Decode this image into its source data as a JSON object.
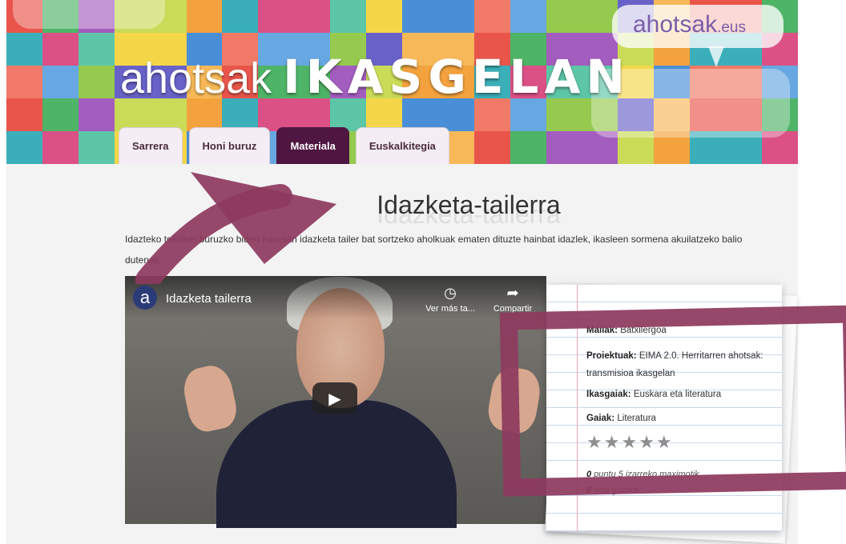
{
  "header": {
    "brand": "ahotsak",
    "brand_suffix": ".eus",
    "site_title_part1": "ahotsak",
    "site_title_part2": "IKASGELAN",
    "tabs": [
      {
        "label": "Sarrera",
        "active": false
      },
      {
        "label": "Honi buruz",
        "active": false
      },
      {
        "label": "Materiala",
        "active": true
      },
      {
        "label": "Euskalkitegia",
        "active": false
      }
    ]
  },
  "main": {
    "title": "Idazketa-tailerra",
    "intro": "Idazteko teknikei buruzko bideo hauetan idazketa tailer bat sortzeko aholkuak ematen dituzte hainbat idazlek, ikasleen sormena akuilatzeko balio dutenak."
  },
  "video": {
    "title": "Idazketa tailerra",
    "logo_letter": "a",
    "watch_later": "Ver más ta...",
    "share": "Compartir"
  },
  "info_card": {
    "mailak_label": "Mailak:",
    "mailak_value": "Batxilergoa",
    "proiektuak_label": "Proiektuak:",
    "proiektuak_value": "EIMA 2.0. Herritarren ahotsak: transmisioa ikasgelan",
    "ikasgaiak_label": "Ikasgaiak:",
    "ikasgaiak_value": "Euskara eta literatura",
    "gaiak_label": "Gaiak:",
    "gaiak_value": "Literatura",
    "rating_value": "0",
    "rating_text": "puntu 5 izarreko maximotik",
    "reviews_value": "0",
    "reviews_text": "iritzi guztira",
    "stars_max": 5,
    "stars_filled": 0
  },
  "colors": {
    "accent": "#8e3a5f",
    "active_tab": "#4e1640",
    "brand": "#7b5ea7"
  }
}
